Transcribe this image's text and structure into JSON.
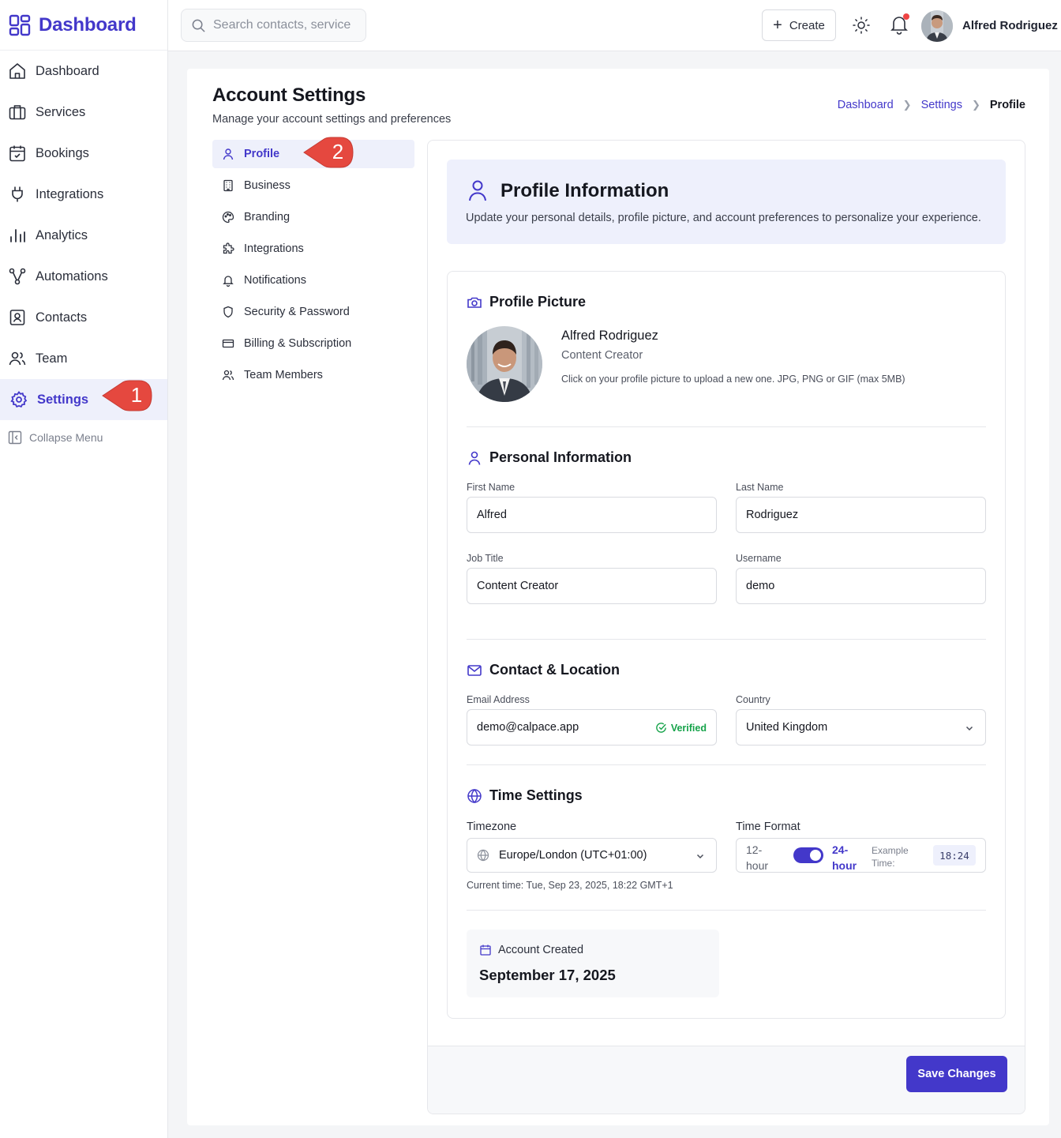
{
  "app": {
    "name": "Dashboard",
    "brand_color": "#4338ca"
  },
  "sidebar": {
    "items": [
      {
        "label": "Dashboard",
        "icon": "home-icon"
      },
      {
        "label": "Services",
        "icon": "briefcase-icon"
      },
      {
        "label": "Bookings",
        "icon": "calendar-icon"
      },
      {
        "label": "Integrations",
        "icon": "plug-icon"
      },
      {
        "label": "Analytics",
        "icon": "bar-chart-icon"
      },
      {
        "label": "Automations",
        "icon": "workflow-icon"
      },
      {
        "label": "Contacts",
        "icon": "contact-card-icon"
      },
      {
        "label": "Team",
        "icon": "users-icon"
      },
      {
        "label": "Settings",
        "icon": "gear-icon",
        "active": true
      }
    ],
    "collapse_label": "Collapse Menu"
  },
  "topbar": {
    "search_placeholder": "Search contacts, service",
    "create_label": "Create",
    "user_name": "Alfred Rodriguez",
    "has_notification": true
  },
  "page": {
    "title": "Account Settings",
    "subtitle": "Manage your account settings and preferences",
    "breadcrumb": [
      "Dashboard",
      "Settings",
      "Profile"
    ]
  },
  "settings_nav": [
    {
      "label": "Profile",
      "icon": "user-icon",
      "active": true
    },
    {
      "label": "Business",
      "icon": "building-icon"
    },
    {
      "label": "Branding",
      "icon": "palette-icon"
    },
    {
      "label": "Integrations",
      "icon": "puzzle-icon"
    },
    {
      "label": "Notifications",
      "icon": "bell-icon"
    },
    {
      "label": "Security & Password",
      "icon": "shield-icon"
    },
    {
      "label": "Billing & Subscription",
      "icon": "credit-card-icon"
    },
    {
      "label": "Team Members",
      "icon": "users-icon"
    }
  ],
  "callouts": {
    "one": "1",
    "two": "2"
  },
  "profile_info": {
    "title": "Profile Information",
    "description": "Update your personal details, profile picture, and account preferences to personalize your experience."
  },
  "profile_picture": {
    "heading": "Profile Picture",
    "name": "Alfred Rodriguez",
    "role": "Content Creator",
    "hint": "Click on your profile picture to upload a new one. JPG, PNG or GIF (max 5MB)"
  },
  "personal": {
    "heading": "Personal Information",
    "first_name_label": "First Name",
    "first_name": "Alfred",
    "last_name_label": "Last Name",
    "last_name": "Rodriguez",
    "job_title_label": "Job Title",
    "job_title": "Content Creator",
    "username_label": "Username",
    "username": "demo"
  },
  "contact": {
    "heading": "Contact & Location",
    "email_label": "Email Address",
    "email": "demo@calpace.app",
    "verified_label": "Verified",
    "country_label": "Country",
    "country": "United Kingdom"
  },
  "time": {
    "heading": "Time Settings",
    "timezone_label": "Timezone",
    "timezone": "Europe/London (UTC+01:00)",
    "format_label": "Time Format",
    "format_12": "12-hour",
    "format_24": "24-hour",
    "format_24_enabled": true,
    "example_label": "Example Time:",
    "example_value": "18:24",
    "current_time": "Current time: Tue, Sep 23, 2025, 18:22 GMT+1"
  },
  "account": {
    "created_label": "Account Created",
    "created_date": "September 17, 2025"
  },
  "footer": {
    "save_label": "Save Changes"
  }
}
